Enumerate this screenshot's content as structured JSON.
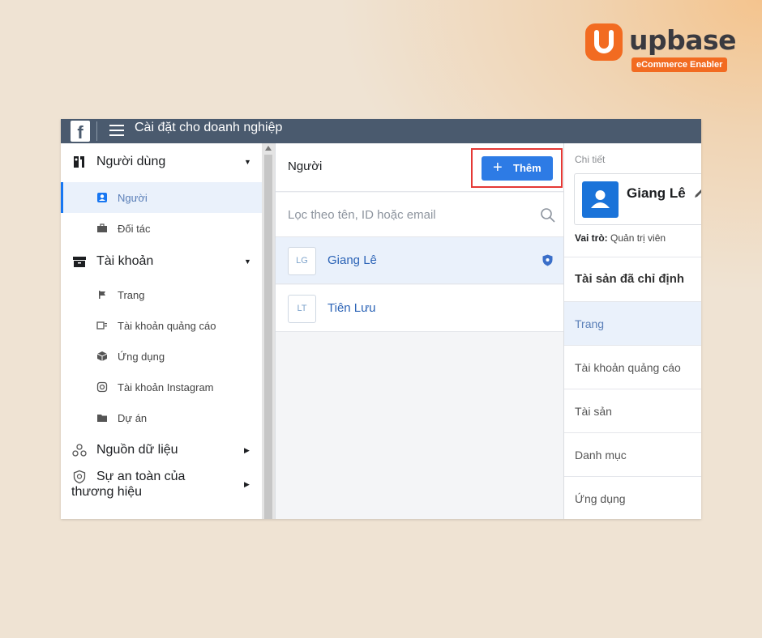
{
  "brand": {
    "name": "upbase",
    "tagline": "eCommerce Enabler",
    "accent": "#f26b21"
  },
  "window": {
    "title": "Cài đặt cho doanh nghiệp",
    "logo_letter": "f"
  },
  "sidebar": {
    "sections": [
      {
        "label": "Người dùng",
        "icon": "users-icon",
        "expanded": true,
        "items": [
          {
            "label": "Người",
            "icon": "person-icon",
            "active": true
          },
          {
            "label": "Đối tác",
            "icon": "briefcase-icon"
          }
        ]
      },
      {
        "label": "Tài khoản",
        "icon": "box-icon",
        "expanded": true,
        "items": [
          {
            "label": "Trang",
            "icon": "flag-icon"
          },
          {
            "label": "Tài khoản quảng cáo",
            "icon": "ad-account-icon"
          },
          {
            "label": "Ứng dụng",
            "icon": "cube-icon"
          },
          {
            "label": "Tài khoản Instagram",
            "icon": "instagram-icon"
          },
          {
            "label": "Dự án",
            "icon": "folder-icon"
          }
        ]
      },
      {
        "label": "Nguồn dữ liệu",
        "icon": "data-sources-icon",
        "expanded": false
      },
      {
        "label": "Sự an toàn của thương hiệu",
        "icon": "shield-icon",
        "expanded": false
      }
    ]
  },
  "people": {
    "header": "Người",
    "add_label": "Thêm",
    "search_placeholder": "Lọc theo tên, ID hoặc email",
    "list": [
      {
        "initials": "LG",
        "name": "Giang Lê",
        "selected": true,
        "admin": true
      },
      {
        "initials": "LT",
        "name": "Tiên Lưu",
        "selected": false,
        "admin": false
      }
    ]
  },
  "detail": {
    "label": "Chi tiết",
    "name": "Giang Lê",
    "role_label": "Vai trò:",
    "role_value": "Quản trị viên",
    "assets_header": "Tài sản đã chỉ định",
    "assets": [
      {
        "label": "Trang",
        "selected": true
      },
      {
        "label": "Tài khoản quảng cáo"
      },
      {
        "label": "Tài sản"
      },
      {
        "label": "Danh mục"
      },
      {
        "label": "Ứng dụng"
      }
    ]
  },
  "colors": {
    "primary_button": "#2d7be5",
    "highlight_border": "#e53935",
    "topbar": "#4a5a6e",
    "selected_row": "#eaf1fb"
  }
}
